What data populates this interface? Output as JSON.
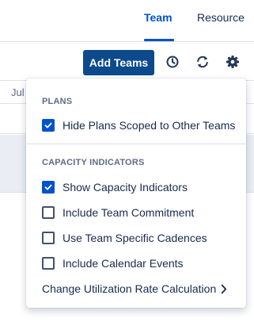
{
  "tabs": [
    {
      "label": "Team",
      "active": true
    },
    {
      "label": "Resource",
      "active": false
    }
  ],
  "toolbar": {
    "add_teams_label": "Add Teams",
    "icons": [
      "history-icon",
      "refresh-icon",
      "settings-icon"
    ]
  },
  "timeline": {
    "month_label": "Jul"
  },
  "dropdown": {
    "plans_heading": "PLANS",
    "plans_options": [
      {
        "label": "Hide Plans Scoped to Other Teams",
        "checked": true
      }
    ],
    "capacity_heading": "CAPACITY INDICATORS",
    "capacity_options": [
      {
        "label": "Show Capacity Indicators",
        "checked": true
      },
      {
        "label": "Include Team Commitment",
        "checked": false
      },
      {
        "label": "Use Team Specific Cadences",
        "checked": false
      },
      {
        "label": "Include Calendar Events",
        "checked": false
      }
    ],
    "utilization_link": "Change Utilization Rate Calculation"
  },
  "colors": {
    "accent": "#0052cc",
    "button_bg": "#0c4a8c",
    "text": "#172b4d",
    "muted": "#5e6c84"
  }
}
